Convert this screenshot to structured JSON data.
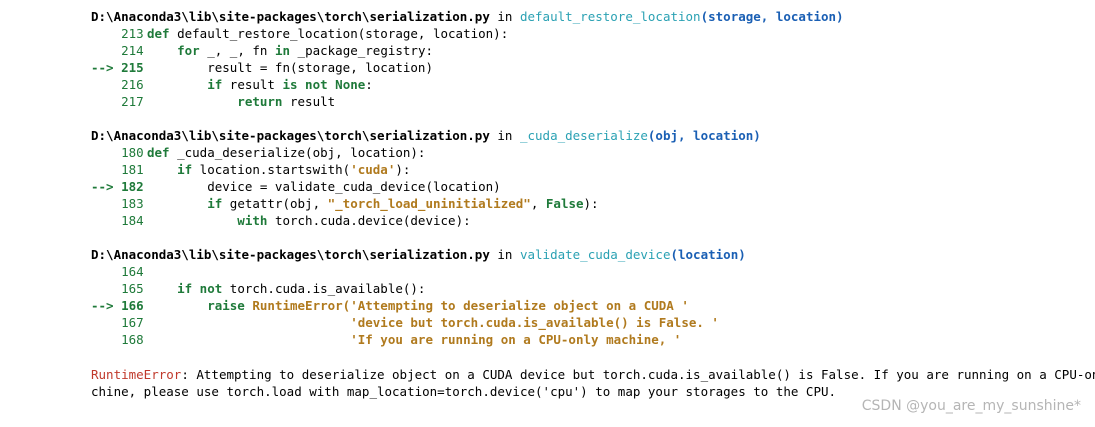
{
  "frames": [
    {
      "path": "D:\\Anaconda3\\lib\\site-packages\\torch\\serialization.py",
      "in_word": " in ",
      "func": "default_restore_location",
      "args": "(storage, location)",
      "lines": [
        {
          "no": "    213",
          "code": [
            {
              "t": "def",
              "c": "kw"
            },
            {
              "t": " default_restore_location(storage, location):",
              "c": "code"
            }
          ]
        },
        {
          "no": "    214",
          "code": [
            {
              "t": "    for",
              "c": "kw"
            },
            {
              "t": " _, _, fn ",
              "c": "code"
            },
            {
              "t": "in",
              "c": "kw"
            },
            {
              "t": " _package_registry:",
              "c": "code"
            }
          ]
        },
        {
          "no": "--> 215",
          "arrow": true,
          "code": [
            {
              "t": "        result = fn(storage, location)",
              "c": "code"
            }
          ]
        },
        {
          "no": "    216",
          "code": [
            {
              "t": "        if",
              "c": "kw"
            },
            {
              "t": " result ",
              "c": "code"
            },
            {
              "t": "is not None",
              "c": "kw"
            },
            {
              "t": ":",
              "c": "code"
            }
          ]
        },
        {
          "no": "    217",
          "code": [
            {
              "t": "            return",
              "c": "kw"
            },
            {
              "t": " result",
              "c": "code"
            }
          ]
        }
      ]
    },
    {
      "path": "D:\\Anaconda3\\lib\\site-packages\\torch\\serialization.py",
      "in_word": " in ",
      "func": "_cuda_deserialize",
      "args": "(obj, location)",
      "lines": [
        {
          "no": "    180",
          "code": [
            {
              "t": "def",
              "c": "kw"
            },
            {
              "t": " _cuda_deserialize(obj, location):",
              "c": "code"
            }
          ]
        },
        {
          "no": "    181",
          "code": [
            {
              "t": "    if",
              "c": "kw"
            },
            {
              "t": " location.startswith(",
              "c": "code"
            },
            {
              "t": "'cuda'",
              "c": "str"
            },
            {
              "t": "):",
              "c": "code"
            }
          ]
        },
        {
          "no": "--> 182",
          "arrow": true,
          "code": [
            {
              "t": "        device = validate_cuda_device(location)",
              "c": "code"
            }
          ]
        },
        {
          "no": "    183",
          "code": [
            {
              "t": "        if",
              "c": "kw"
            },
            {
              "t": " getattr(obj, ",
              "c": "code"
            },
            {
              "t": "\"_torch_load_uninitialized\"",
              "c": "str"
            },
            {
              "t": ", ",
              "c": "code"
            },
            {
              "t": "False",
              "c": "kw"
            },
            {
              "t": "):",
              "c": "code"
            }
          ]
        },
        {
          "no": "    184",
          "code": [
            {
              "t": "            with",
              "c": "kw"
            },
            {
              "t": " torch.cuda.device(device):",
              "c": "code"
            }
          ]
        }
      ]
    },
    {
      "path": "D:\\Anaconda3\\lib\\site-packages\\torch\\serialization.py",
      "in_word": " in ",
      "func": "validate_cuda_device",
      "args": "(location)",
      "lines": [
        {
          "no": "    164",
          "code": []
        },
        {
          "no": "    165",
          "code": [
            {
              "t": "    if not",
              "c": "kw"
            },
            {
              "t": " torch.cuda.is_available():",
              "c": "code"
            }
          ]
        },
        {
          "no": "--> 166",
          "arrow": true,
          "code": [
            {
              "t": "        raise",
              "c": "kw"
            },
            {
              "t": " RuntimeError(",
              "c": "str"
            },
            {
              "t": "'Attempting to deserialize object on a CUDA '",
              "c": "str"
            }
          ]
        },
        {
          "no": "    167",
          "code": [
            {
              "t": "                           'device but torch.cuda.is_available() is False. '",
              "c": "str"
            }
          ]
        },
        {
          "no": "    168",
          "code": [
            {
              "t": "                           'If you are running on a CPU-only machine, '",
              "c": "str"
            }
          ]
        }
      ]
    }
  ],
  "error": {
    "name": "RuntimeError",
    "line1_rest": ": Attempting to deserialize object on a CUDA device but torch.cuda.is_available() is False. If you are running on a CPU-only ma",
    "line2": "chine, please use torch.load with map_location=torch.device('cpu') to map your storages to the CPU."
  },
  "watermark": "CSDN @you_are_my_sunshine*"
}
